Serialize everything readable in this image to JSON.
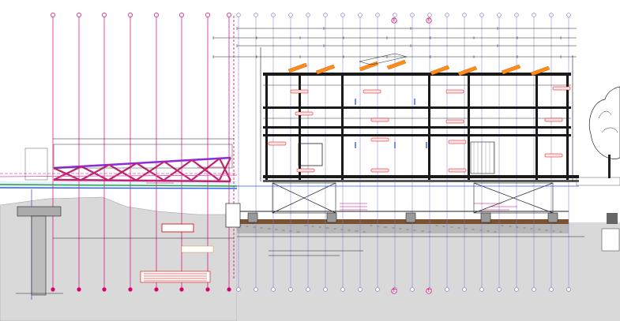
{
  "drawing": {
    "type": "cad-section",
    "colors": {
      "grid_magenta": "#d8006f",
      "grid_blue": "#7a78c8",
      "truss": "#c0246e",
      "truss_top": "#8a2be2",
      "pipe_green": "#2a9a3a",
      "pipe_blue": "#2d5ff0",
      "ground": "#d9d9d9",
      "soil": "#7a5232",
      "roof_panel": "#ff8c1a",
      "steel": "#1a1a1a",
      "tag_fill": "#ffe5e5",
      "tag_stroke": "#e00000"
    },
    "grid": {
      "top_markers": [
        "",
        "",
        "",
        "",
        "",
        "",
        "",
        ""
      ],
      "circle_labels": [
        "E",
        "E"
      ],
      "bottom_labels": [
        "E",
        "E"
      ]
    },
    "notes": {
      "red_box_1": "",
      "red_box_2": ""
    }
  }
}
